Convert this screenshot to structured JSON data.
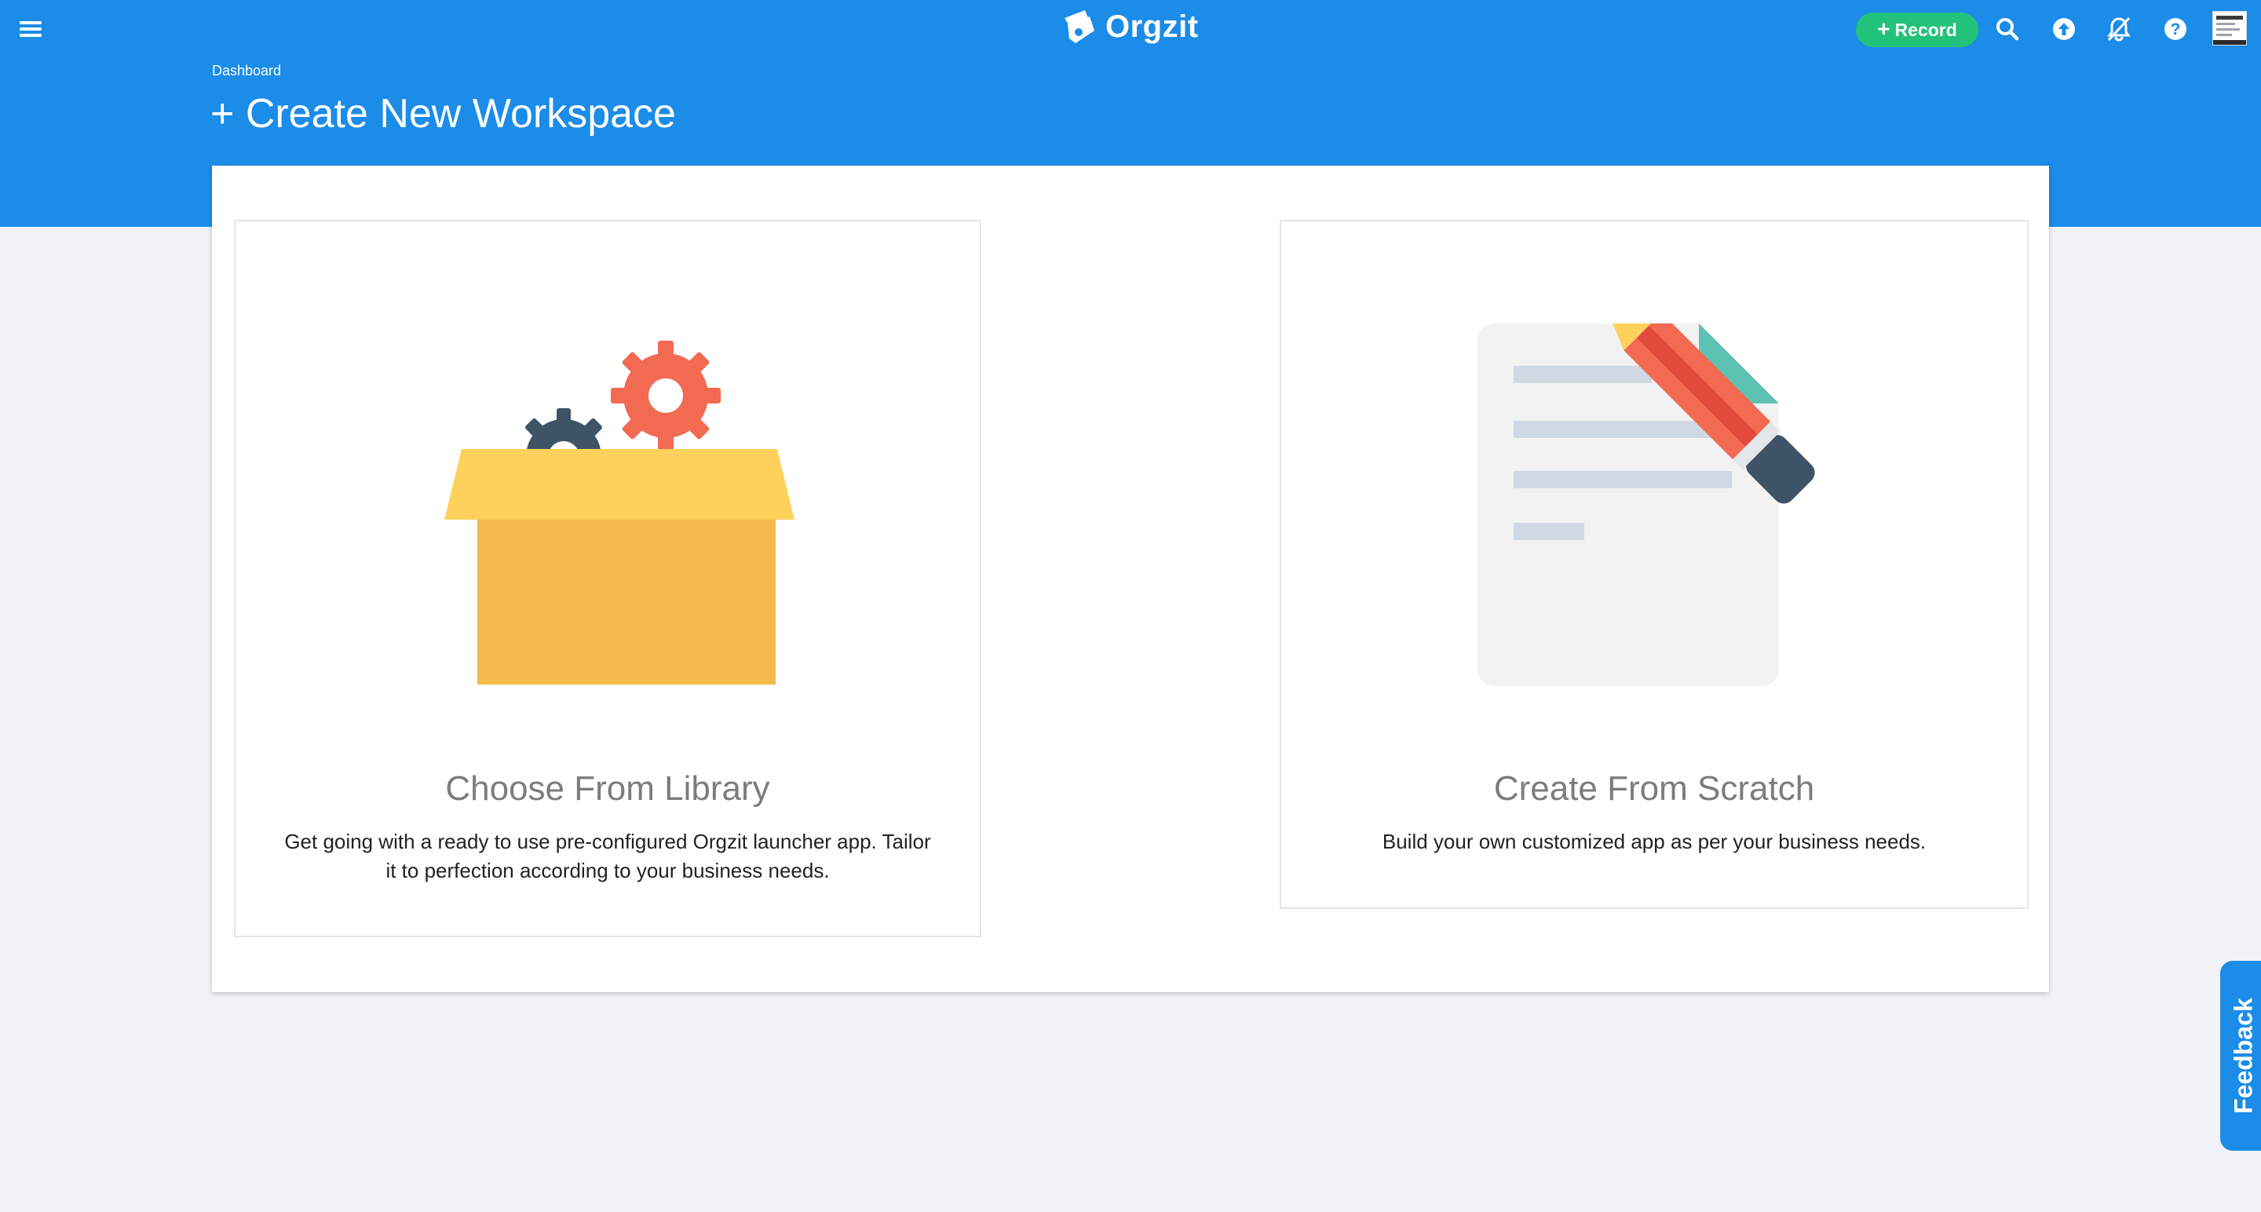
{
  "header": {
    "brand_name": "Orgzit",
    "record_button": {
      "icon": "plus-icon",
      "label": "Record"
    },
    "icons": [
      "menu-icon",
      "search-icon",
      "upload-icon",
      "notifications-off-icon",
      "help-icon"
    ]
  },
  "breadcrumb": {
    "label": "Dashboard"
  },
  "page": {
    "title": "+ Create New Workspace"
  },
  "options": [
    {
      "title": "Choose From Library",
      "description": "Get going with a ready to use pre-configured Orgzit launcher app. Tailor it to perfection according to your business needs.",
      "illustration": "box-with-gears-icon"
    },
    {
      "title": "Create From Scratch",
      "description": "Build your own customized app as per your business needs.",
      "illustration": "document-pencil-icon"
    }
  ],
  "feedback": {
    "label": "Feedback"
  },
  "colors": {
    "header_blue": "#1b8ce8",
    "record_green": "#22c27a",
    "page_background": "#f0f3f8",
    "card_title_gray": "#7c7c7c"
  }
}
